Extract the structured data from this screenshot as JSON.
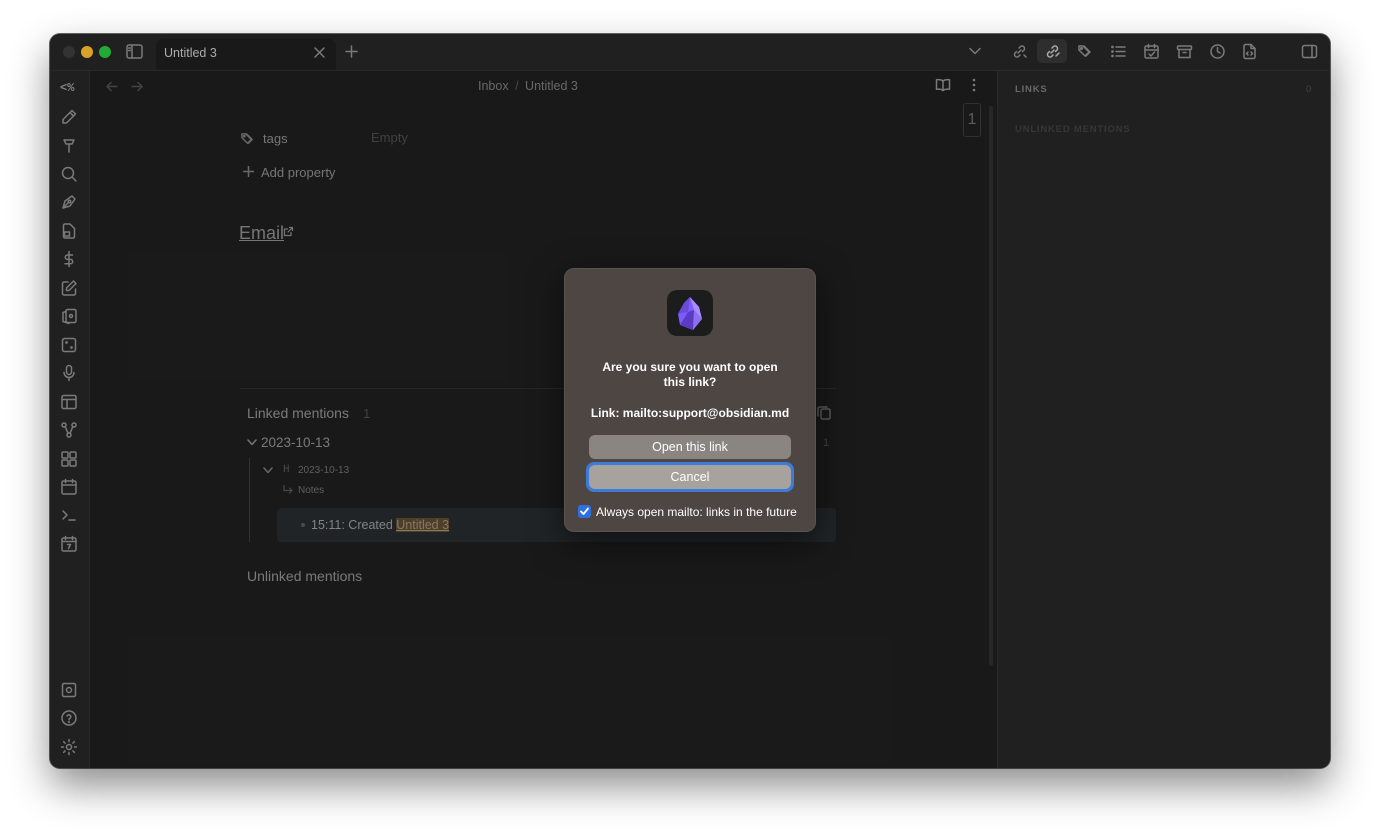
{
  "tabs": [
    {
      "label": "Untitled 3"
    }
  ],
  "breadcrumb": {
    "folder": "Inbox",
    "sep": "/",
    "note": "Untitled 3"
  },
  "ribbon": {
    "top_label": "<%"
  },
  "properties": {
    "tags_label": "tags",
    "tags_value": "Empty",
    "add_label": "Add property"
  },
  "note": {
    "link_text": "Email",
    "page_counter": "1"
  },
  "backlinks": {
    "linked_title": "Linked mentions",
    "linked_count": "1",
    "group_title": "2023-10-13",
    "group_count": "1",
    "heading": "2023-10-13",
    "subheading": "Notes",
    "item_prefix": "15:11: Created ",
    "item_link": "Untitled 3",
    "unlinked_title": "Unlinked mentions"
  },
  "sidebar": {
    "links_title": "LINKS",
    "links_count": "0",
    "unlinked_title": "UNLINKED MENTIONS"
  },
  "dialog": {
    "question": "Are you sure you want to open this link?",
    "link_info": "Link: mailto:support@obsidian.md",
    "open_label": "Open this link",
    "cancel_label": "Cancel",
    "checkbox_label": "Always open mailto: links in the future",
    "checkbox_checked": true
  },
  "colors": {
    "accent": "#7c5cff",
    "dialog_bg": "#4d4643",
    "focus_ring": "#3d7bd9"
  }
}
